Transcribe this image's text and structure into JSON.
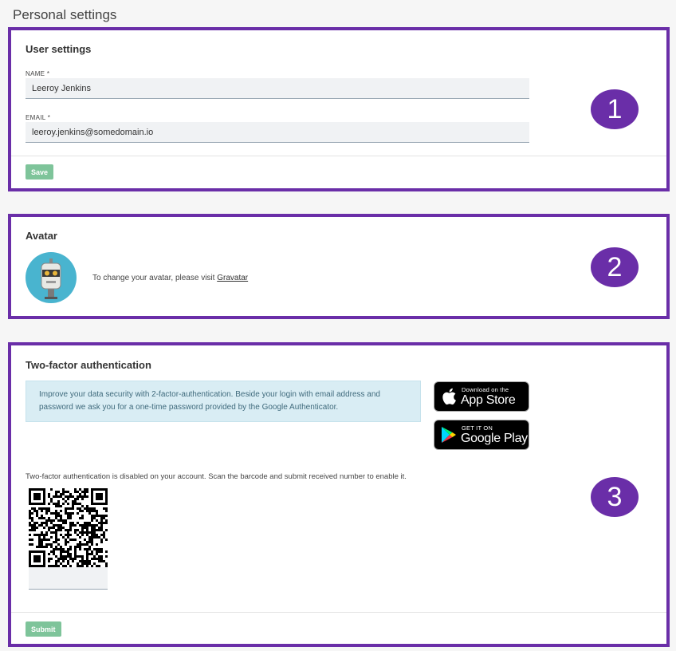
{
  "page": {
    "title": "Personal settings"
  },
  "user_settings": {
    "title": "User settings",
    "name_label": "NAME *",
    "name_value": "Leeroy Jenkins",
    "email_label": "EMAIL *",
    "email_value": "leeroy.jenkins@somedomain.io",
    "save_label": "Save",
    "badge": "1"
  },
  "avatar": {
    "title": "Avatar",
    "text": "To change your avatar, please visit",
    "link": "Gravatar",
    "badge": "2"
  },
  "two_factor": {
    "title": "Two-factor authentication",
    "info": "Improve your data security with 2-factor-authentication. Beside your login with email address and password we ask you for a one-time password provided by the Google Authenticator.",
    "app_store": {
      "small": "Download on the",
      "big": "App Store",
      "icon": "apple-icon"
    },
    "google_play": {
      "small": "GET IT ON",
      "big": "Google Play",
      "icon": "google-play-icon"
    },
    "status": "Two-factor authentication is disabled on your account. Scan the barcode and submit received number to enable it.",
    "submit_label": "Submit",
    "badge": "3"
  },
  "colors": {
    "frame": "#6a2ea8",
    "button": "#7ec49a",
    "info_bg": "#d9edf4",
    "avatar_bg": "#49b4cf"
  }
}
